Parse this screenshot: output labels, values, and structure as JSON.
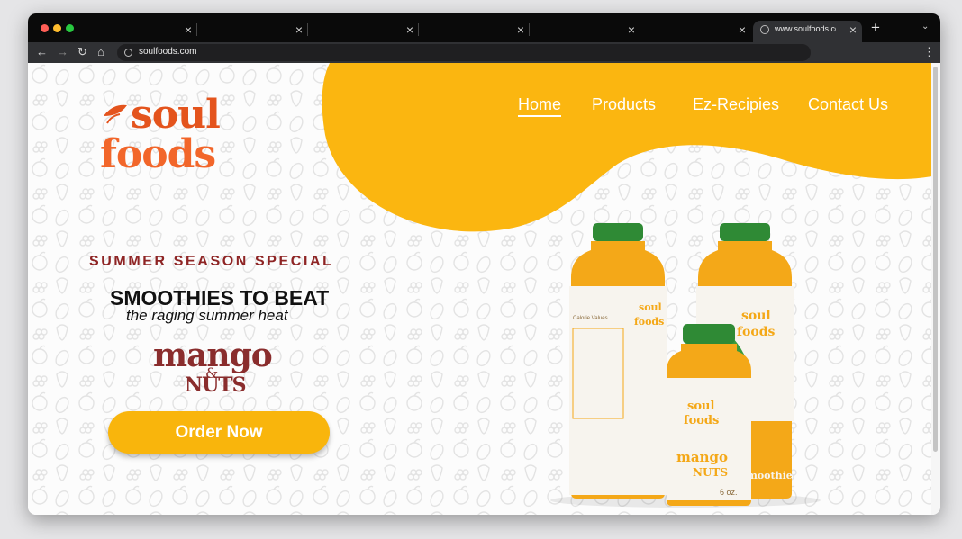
{
  "browser": {
    "tabs": [
      {
        "title": "",
        "close": "×"
      },
      {
        "title": "",
        "close": "×"
      },
      {
        "title": "",
        "close": "×"
      },
      {
        "title": "",
        "close": "×"
      },
      {
        "title": "",
        "close": "×"
      },
      {
        "title": "",
        "close": "×"
      },
      {
        "title": "www.soulfoods.com",
        "close": "×",
        "active": true
      }
    ],
    "new_tab": "+",
    "tab_menu": "⌄",
    "back": "←",
    "forward": "→",
    "reload": "↻",
    "home": "⌂",
    "url": "soulfoods.com",
    "menu": "⋮"
  },
  "site": {
    "logo": {
      "line1": "soul",
      "line2": "foods"
    },
    "nav": [
      "Home",
      "Products",
      "Ez-Recipies",
      "Contact Us"
    ],
    "hero": {
      "kicker": "SUMMER SEASON SPECIAL",
      "headline": "SMOOTHIES TO BEAT",
      "subline": "the raging summer heat",
      "product_line1": "mango",
      "product_amp": "&",
      "product_line2": "NUTS",
      "cta": "Order Now"
    },
    "bottle_labels": {
      "brand1": "soul",
      "brand2": "foods",
      "flavor1": "mango",
      "flavor2": "NUTS",
      "size_small": "6 oz.",
      "smoothie": "smoothie",
      "nutrition": "Calorie Values"
    }
  },
  "colors": {
    "accent_yellow": "#f9b50c",
    "brand_orange": "#f2662a",
    "maroon": "#8e2424",
    "bottle_juice": "#f4a818",
    "cap_green": "#2f8a35"
  }
}
